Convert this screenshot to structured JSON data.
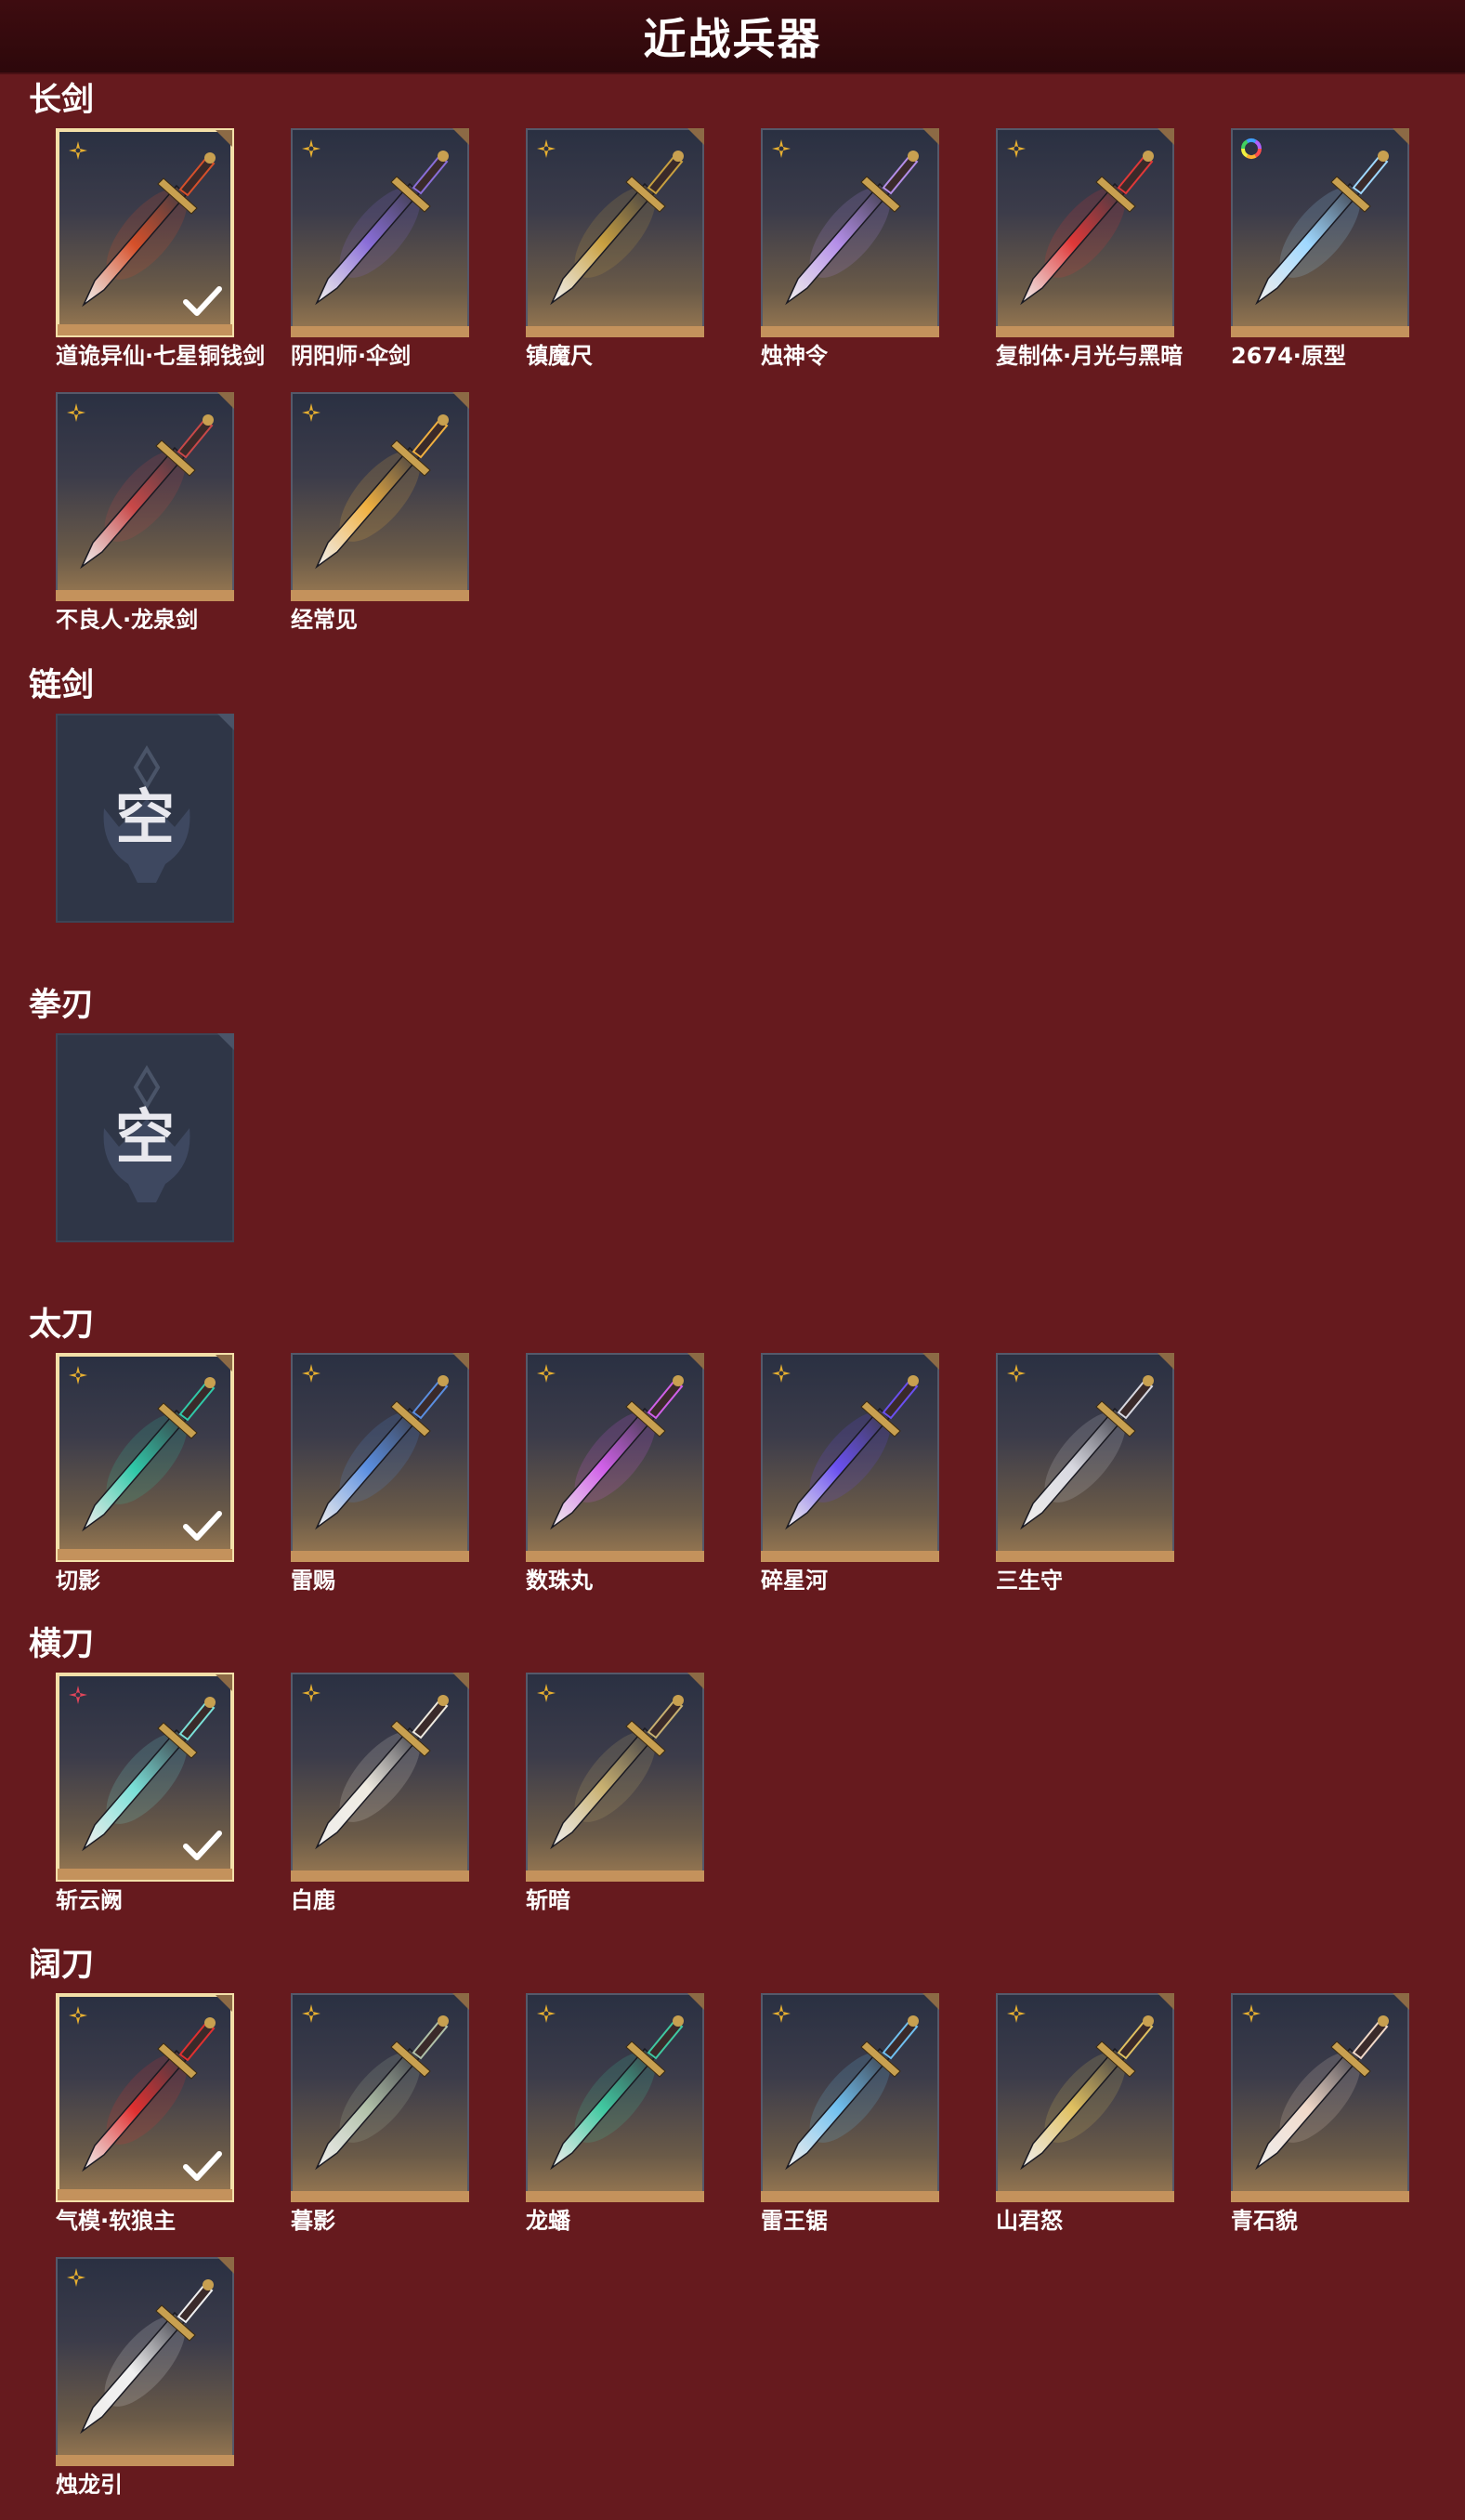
{
  "header": {
    "title": "近战兵器"
  },
  "empty_label": "空",
  "colors": {
    "background": "#661a1e",
    "selected_border": "#f3dfa8",
    "rarity_gold": "#e8b030",
    "rarity_red": "#e0455a"
  },
  "sections": [
    {
      "title": "长剑",
      "items": [
        {
          "name": "道诡异仙·七星铜钱剑",
          "selected": true,
          "rarity": "gold",
          "hue": "#d6502a"
        },
        {
          "name": "阴阳师·伞剑",
          "selected": false,
          "rarity": "gold",
          "hue": "#8a6ed8"
        },
        {
          "name": "镇魔尺",
          "selected": false,
          "rarity": "gold",
          "hue": "#c8a040"
        },
        {
          "name": "烛神令",
          "selected": false,
          "rarity": "gold",
          "hue": "#b48ee8"
        },
        {
          "name": "复制体·月光与黑暗",
          "selected": false,
          "rarity": "gold",
          "hue": "#e03838"
        },
        {
          "name": "2674·原型",
          "selected": false,
          "rarity": "rainbow",
          "hue": "#9fd8ff"
        },
        {
          "name": "不良人·龙泉剑",
          "selected": false,
          "rarity": "gold",
          "hue": "#c84848"
        },
        {
          "name": "经常见",
          "selected": false,
          "rarity": "gold",
          "hue": "#f0b040"
        }
      ]
    },
    {
      "title": "链剑",
      "items": []
    },
    {
      "title": "拳刃",
      "items": []
    },
    {
      "title": "太刀",
      "items": [
        {
          "name": "切影",
          "selected": true,
          "rarity": "gold",
          "hue": "#30c8a8"
        },
        {
          "name": "雷赐",
          "selected": false,
          "rarity": "gold",
          "hue": "#5a8ee0"
        },
        {
          "name": "数珠丸",
          "selected": false,
          "rarity": "gold",
          "hue": "#d060e8"
        },
        {
          "name": "碎星河",
          "selected": false,
          "rarity": "gold",
          "hue": "#6a50f0"
        },
        {
          "name": "三生守",
          "selected": false,
          "rarity": "gold",
          "hue": "#d8d8e0"
        }
      ]
    },
    {
      "title": "横刀",
      "items": [
        {
          "name": "斩云阙",
          "selected": true,
          "rarity": "red",
          "hue": "#7ae0d8"
        },
        {
          "name": "白鹿",
          "selected": false,
          "rarity": "gold",
          "hue": "#eeeae0"
        },
        {
          "name": "斩暗",
          "selected": false,
          "rarity": "gold",
          "hue": "#c8b070"
        }
      ]
    },
    {
      "title": "阔刀",
      "items": [
        {
          "name": "气模·软狼主",
          "selected": true,
          "rarity": "gold",
          "hue": "#e03030"
        },
        {
          "name": "暮影",
          "selected": false,
          "rarity": "gold",
          "hue": "#b0c0a8"
        },
        {
          "name": "龙蟠",
          "selected": false,
          "rarity": "gold",
          "hue": "#40c8a0"
        },
        {
          "name": "雷王锯",
          "selected": false,
          "rarity": "gold",
          "hue": "#70c0f0"
        },
        {
          "name": "山君怒",
          "selected": false,
          "rarity": "gold",
          "hue": "#e0c060"
        },
        {
          "name": "青石貌",
          "selected": false,
          "rarity": "gold",
          "hue": "#f0d8c8"
        },
        {
          "name": "烛龙引",
          "selected": false,
          "rarity": "gold",
          "hue": "#f0f0f0"
        }
      ]
    }
  ]
}
